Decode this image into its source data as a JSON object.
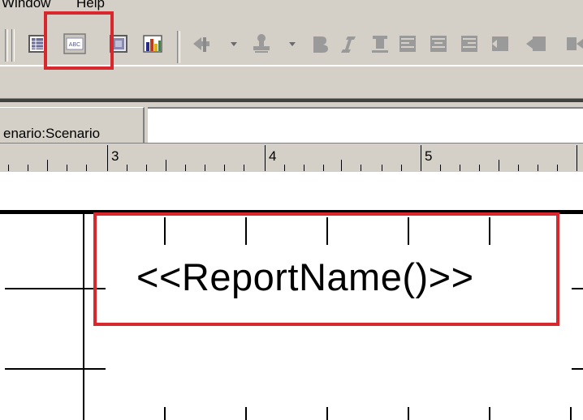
{
  "menubar": {
    "items": [
      {
        "label": "Window"
      },
      {
        "label": "Help"
      }
    ]
  },
  "toolbar": {
    "buttons": [
      {
        "icon": "grid-table-icon"
      },
      {
        "icon": "text-field-icon",
        "label": "ABC"
      },
      {
        "icon": "image-icon"
      },
      {
        "icon": "bar-chart-icon"
      },
      {
        "icon": "pointer-arrow-icon"
      },
      {
        "icon": "stamp-icon"
      },
      {
        "icon": "bold-icon"
      },
      {
        "icon": "italic-icon"
      },
      {
        "icon": "underline-icon"
      },
      {
        "icon": "align-left-icon"
      },
      {
        "icon": "align-center-icon"
      },
      {
        "icon": "align-right-icon"
      },
      {
        "icon": "outdent-icon"
      },
      {
        "icon": "indent-icon"
      }
    ]
  },
  "tab": {
    "label": "enario:Scenario"
  },
  "ruler": {
    "labels": [
      "3",
      "4",
      "5"
    ]
  },
  "canvas": {
    "field_text": "<<ReportName()>>"
  },
  "colors": {
    "highlight": "#d9272e",
    "chrome": "#d4d0c8"
  }
}
